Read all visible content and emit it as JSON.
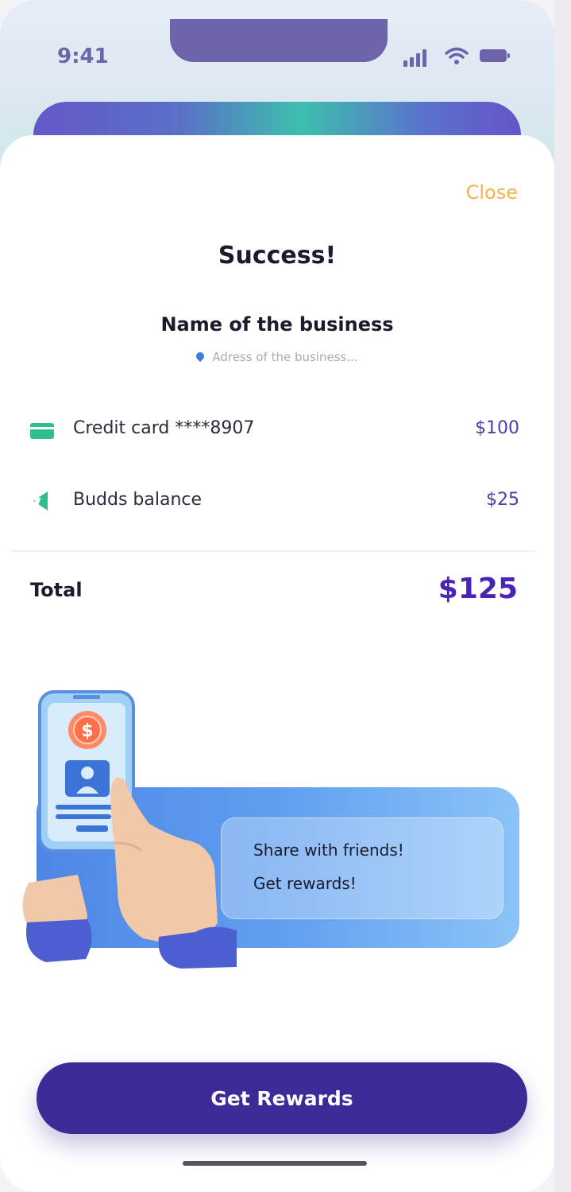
{
  "status_bar": {
    "time": "9:41"
  },
  "header": {
    "close_label": "Close"
  },
  "content": {
    "title": "Success!",
    "business_name": "Name of the business",
    "business_address": "Adress of the business..."
  },
  "payments": [
    {
      "label": "Credit card ****8907",
      "amount": "$100",
      "icon": "credit-card-icon"
    },
    {
      "label": "Budds balance",
      "amount": "$25",
      "icon": "budds-logo-icon"
    }
  ],
  "total": {
    "label": "Total",
    "amount": "$125"
  },
  "promo": {
    "line1": "Share with friends!",
    "line2": "Get rewards!"
  },
  "cta": {
    "label": "Get Rewards"
  },
  "colors": {
    "accent": "#3e2a96",
    "close": "#f4b34a",
    "total": "#4a23b8",
    "success_green": "#2fbf8c"
  }
}
